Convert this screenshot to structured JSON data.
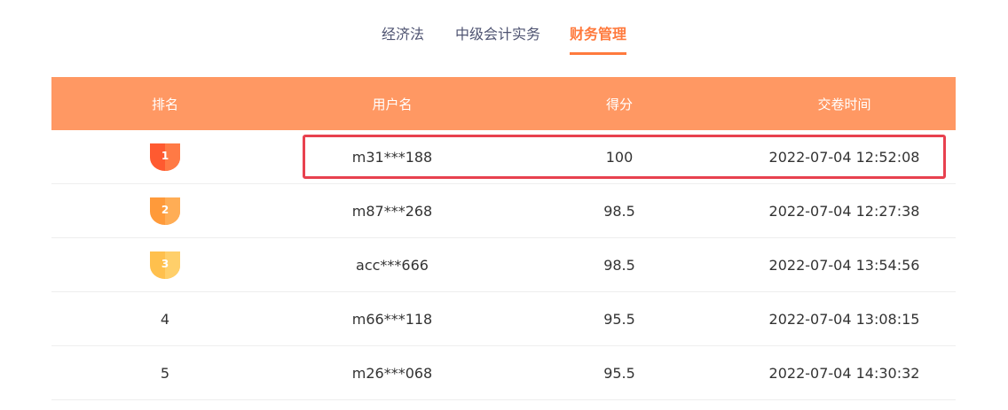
{
  "tabs": [
    {
      "label": "经济法",
      "active": false
    },
    {
      "label": "中级会计实务",
      "active": false
    },
    {
      "label": "财务管理",
      "active": true
    }
  ],
  "table": {
    "headers": [
      "排名",
      "用户名",
      "得分",
      "交卷时间"
    ],
    "rows": [
      {
        "rank": "1",
        "user": "m31***188",
        "score": "100",
        "time": "2022-07-04 12:52:08",
        "medal": "gold"
      },
      {
        "rank": "2",
        "user": "m87***268",
        "score": "98.5",
        "time": "2022-07-04 12:27:38",
        "medal": "silver"
      },
      {
        "rank": "3",
        "user": "acc***666",
        "score": "98.5",
        "time": "2022-07-04 13:54:56",
        "medal": "bronze"
      },
      {
        "rank": "4",
        "user": "m66***118",
        "score": "95.5",
        "time": "2022-07-04 13:08:15",
        "medal": ""
      },
      {
        "rank": "5",
        "user": "m26***068",
        "score": "95.5",
        "time": "2022-07-04 14:30:32",
        "medal": ""
      }
    ]
  },
  "colors": {
    "accent": "#ff7a3d",
    "header_bg": "#ff9863",
    "highlight": "#e8414f",
    "medal_gold": "#ff5a30",
    "medal_silver": "#ff9a3a",
    "medal_bronze": "#ffc04d"
  }
}
